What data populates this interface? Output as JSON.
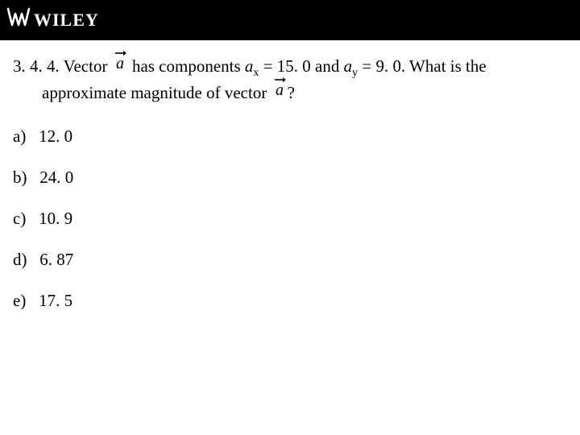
{
  "brand": {
    "name": "WILEY"
  },
  "question": {
    "number": "3. 4. 4.",
    "part1": "Vector",
    "part2": "has components",
    "ax_var": "a",
    "ax_sub": "x",
    "eq1": " = ",
    "ax_val": "15. 0",
    "and": " and ",
    "ay_var": "a",
    "ay_sub": "y",
    "eq2": " = ",
    "ay_val": "9. 0",
    "tail1": ".  What is the",
    "line2a": "approximate magnitude of vector",
    "qmark": "?"
  },
  "vector_glyph": "a",
  "options": [
    {
      "label": "a)",
      "text": "12. 0"
    },
    {
      "label": "b)",
      "text": "24. 0"
    },
    {
      "label": "c)",
      "text": "10. 9"
    },
    {
      "label": "d)",
      "text": "6. 87"
    },
    {
      "label": "e)",
      "text": "17. 5"
    }
  ]
}
